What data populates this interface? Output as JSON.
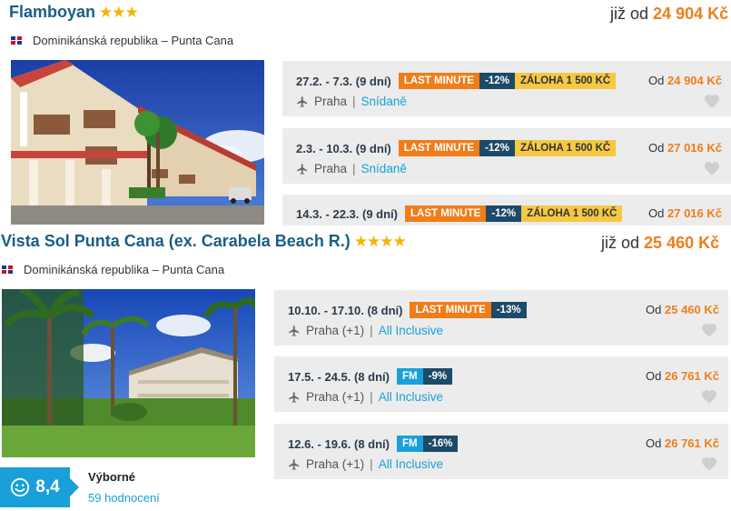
{
  "icons": {
    "flag": "flag-dominican-republic-icon",
    "plane": "plane-icon",
    "heart": "heart-icon",
    "smile": "smile-icon",
    "stars": "star-icon"
  },
  "colors": {
    "accent": "#f07d1a",
    "link": "#1a9fd8",
    "title": "#1a5e86",
    "discount": "#1c4a68",
    "deposit": "#f6c843",
    "fm": "#1aa0d8"
  },
  "hotels": [
    {
      "name": "Flamboyan",
      "stars": "★★★",
      "price_prefix": "již od",
      "price": "24 904 Kč",
      "location": "Dominikánská republika – Punta Cana",
      "offers": [
        {
          "dates": "27.2. - 7.3. (9 dní)",
          "badge1": "LAST MINUTE",
          "discount": "-12%",
          "deposit": "ZÁLOHA 1 500 KČ",
          "city": "Praha",
          "meal": "Snídaně",
          "od": "Od",
          "price": "24 904 Kč"
        },
        {
          "dates": "2.3. - 10.3. (9 dní)",
          "badge1": "LAST MINUTE",
          "discount": "-12%",
          "deposit": "ZÁLOHA 1 500 KČ",
          "city": "Praha",
          "meal": "Snídaně",
          "od": "Od",
          "price": "27 016 Kč"
        },
        {
          "dates": "14.3. - 22.3. (9 dní)",
          "badge1": "LAST MINUTE",
          "discount": "-12%",
          "deposit": "ZÁLOHA 1 500 KČ",
          "od": "Od",
          "price": "27 016 Kč"
        }
      ]
    },
    {
      "name": "Vista Sol Punta Cana (ex. Carabela Beach R.)",
      "stars": "★★★★",
      "price_prefix": "již od",
      "price": "25 460 Kč",
      "location": "Dominikánská republika – Punta Cana",
      "rating": {
        "score": "8,4",
        "label": "Výborné",
        "count": "59 hodnocení"
      },
      "offers": [
        {
          "dates": "10.10. - 17.10. (8 dní)",
          "badge1": "LAST MINUTE",
          "discount": "-13%",
          "city": "Praha (+1)",
          "meal": "All Inclusive",
          "od": "Od",
          "price": "25 460 Kč"
        },
        {
          "dates": "17.5. - 24.5. (8 dní)",
          "badge1": "FM",
          "discount": "-9%",
          "city": "Praha (+1)",
          "meal": "All Inclusive",
          "od": "Od",
          "price": "26 761 Kč"
        },
        {
          "dates": "12.6. - 19.6. (8 dní)",
          "badge1": "FM",
          "discount": "-16%",
          "city": "Praha (+1)",
          "meal": "All Inclusive",
          "od": "Od",
          "price": "26 761 Kč"
        }
      ]
    }
  ]
}
